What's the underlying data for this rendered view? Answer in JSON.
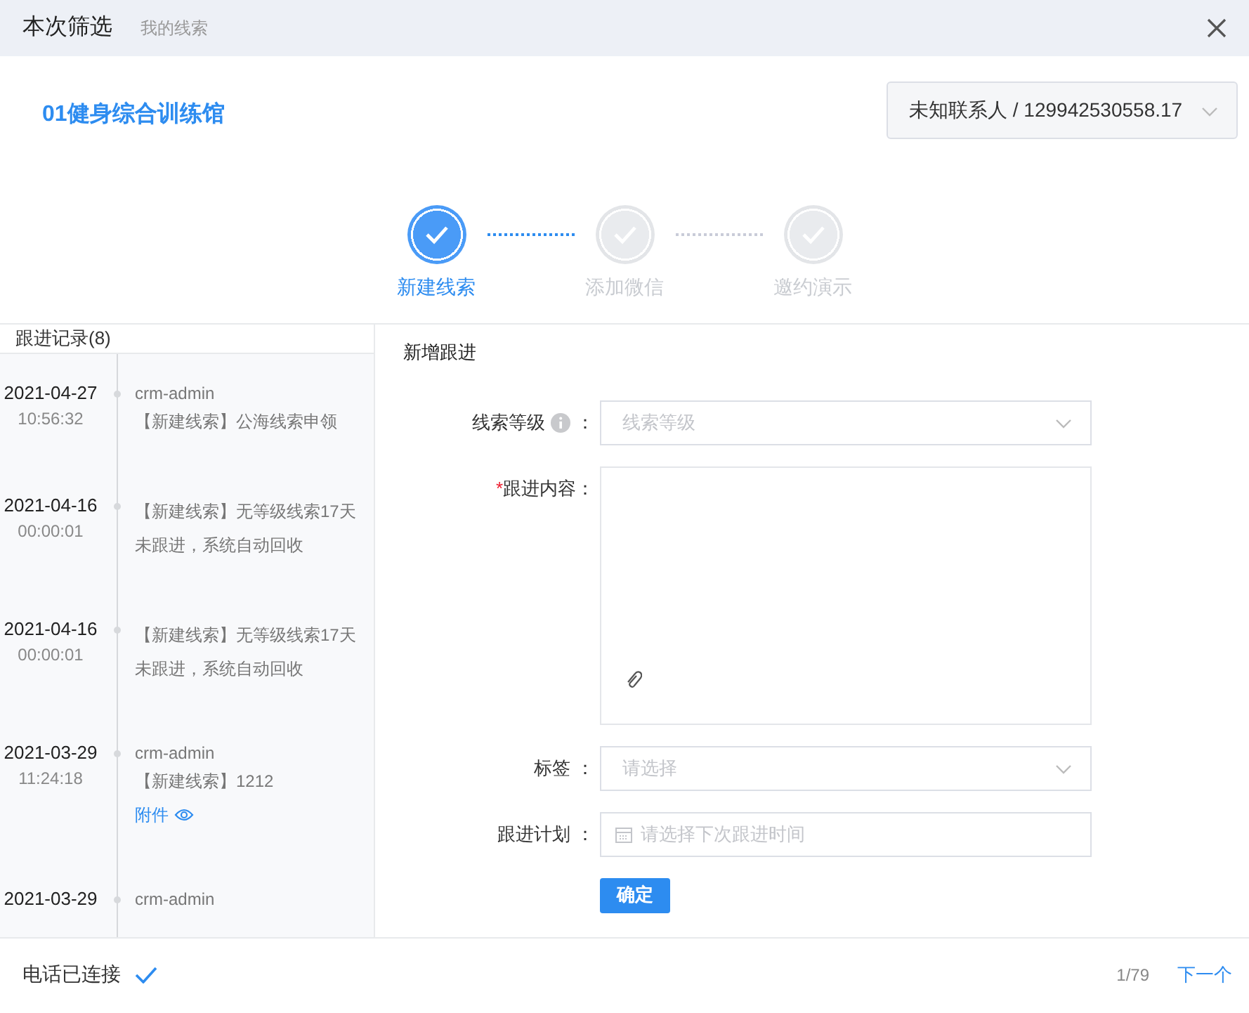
{
  "header": {
    "title": "本次筛选",
    "subtitle": "我的线索"
  },
  "company": "01健身综合训练馆",
  "contact_select": {
    "value": "未知联系人 / 129942530558.17"
  },
  "steps": [
    {
      "label": "新建线索",
      "done": true
    },
    {
      "label": "添加微信",
      "done": false
    },
    {
      "label": "邀约演示",
      "done": false
    }
  ],
  "records": {
    "title": "跟进记录(8)",
    "items": [
      {
        "date": "2021-04-27",
        "time": "10:56:32",
        "author": "crm-admin",
        "text": "【新建线索】公海线索申领"
      },
      {
        "date": "2021-04-16",
        "time": "00:00:01",
        "text": "【新建线索】无等级线索17天未跟进，系统自动回收"
      },
      {
        "date": "2021-04-16",
        "time": "00:00:01",
        "text": "【新建线索】无等级线索17天未跟进，系统自动回收"
      },
      {
        "date": "2021-03-29",
        "time": "11:24:18",
        "author": "crm-admin",
        "text": "【新建线索】1212",
        "attachment": "附件"
      },
      {
        "date": "2021-03-29",
        "author": "crm-admin"
      }
    ]
  },
  "form": {
    "title": "新增跟进",
    "fields": [
      {
        "kind": "select",
        "label": "线索等级",
        "info": true,
        "colon": "：",
        "placeholder": "线索等级"
      },
      {
        "kind": "textarea",
        "required_mark": "*",
        "label": "跟进内容",
        "info": false,
        "colon": "："
      },
      {
        "kind": "select",
        "label": "标签",
        "info": false,
        "colon": "：",
        "placeholder": "请选择"
      },
      {
        "kind": "date",
        "label": "跟进计划",
        "info": false,
        "colon": "：",
        "placeholder": "请选择下次跟进时间"
      }
    ],
    "submit": "确定"
  },
  "footer": {
    "status": "电话已连接",
    "connected": true,
    "page": "1/79",
    "next": "下一个"
  }
}
